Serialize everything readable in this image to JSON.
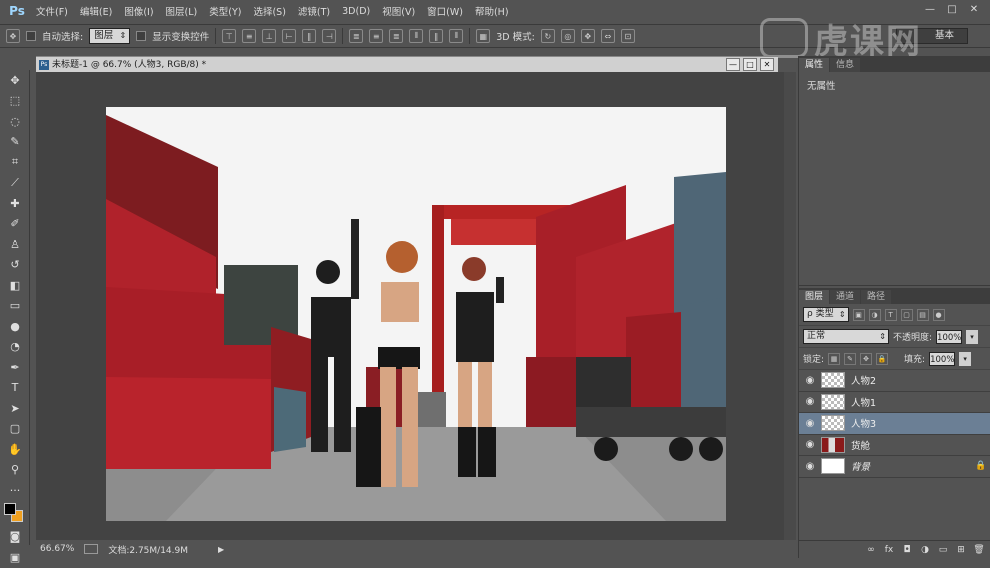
{
  "app": {
    "logo": "Ps",
    "menu": [
      "文件(F)",
      "编辑(E)",
      "图像(I)",
      "图层(L)",
      "类型(Y)",
      "选择(S)",
      "滤镜(T)",
      "3D(D)",
      "视图(V)",
      "窗口(W)",
      "帮助(H)"
    ],
    "window_controls": [
      "—",
      "□",
      "✕"
    ]
  },
  "watermark": {
    "text": "虎课网"
  },
  "options_bar": {
    "auto_select_label": "自动选择:",
    "auto_select_value": "图层",
    "show_transform_label": "显示变换控件",
    "mode_3d_label": "3D 模式:",
    "workspace_value": "基本"
  },
  "document": {
    "tab_title": "未标题-1 @ 66.7% (人物3, RGB/8) *",
    "tab_icon": "Ps",
    "controls": [
      "—",
      "□",
      "✕"
    ]
  },
  "status": {
    "zoom": "66.67%",
    "doc_info": "文档:2.75M/14.9M",
    "arrow": "▶"
  },
  "properties_panel": {
    "tabs": [
      "属性",
      "信息"
    ],
    "body_text": "无属性"
  },
  "layers_panel": {
    "tabs": [
      "图层",
      "通道",
      "路径"
    ],
    "filter_kind": "ρ 类型",
    "blend_mode": "正常",
    "opacity_label": "不透明度:",
    "opacity_value": "100%",
    "lock_label": "锁定:",
    "fill_label": "填充:",
    "fill_value": "100%",
    "layers": [
      {
        "name": "人物2",
        "thumb": "transparent",
        "selected": false
      },
      {
        "name": "人物1",
        "thumb": "transparent",
        "selected": false
      },
      {
        "name": "人物3",
        "thumb": "transparent",
        "selected": true
      },
      {
        "name": "货舱",
        "thumb": "scene",
        "selected": false
      },
      {
        "name": "背景",
        "thumb": "white",
        "selected": false,
        "locked": true
      }
    ]
  },
  "colors": {
    "ui_bg": "#535353",
    "selected_layer": "#6b7f95",
    "foreground": "#000000",
    "background": "#f0a020"
  }
}
